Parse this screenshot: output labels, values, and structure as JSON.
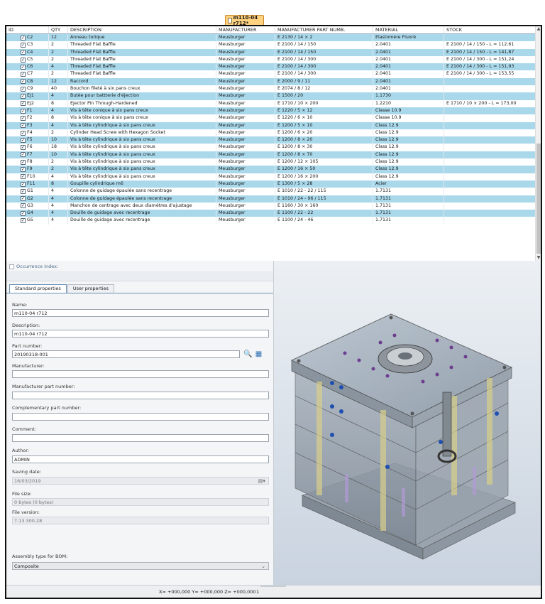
{
  "doc_tab": {
    "label": "m110-04 r712*"
  },
  "grid": {
    "columns": [
      "ID",
      "QTY",
      "DESCRIPTION",
      "MANUFACTURER",
      "MANUFACTURER PART NUMB.",
      "MATERIAL",
      "STOCK"
    ],
    "rows": [
      {
        "id": "C2",
        "qty": "12",
        "desc": "Anneau torique",
        "man": "Meusburger",
        "mpn": "E 2130 / 14 × 2",
        "mat": "Elastomère Fluoré",
        "stock": "",
        "sel": true
      },
      {
        "id": "C3",
        "qty": "2",
        "desc": "Threaded Flat Baffle",
        "man": "Meusburger",
        "mpn": "E 2100 / 14 / 150",
        "mat": "2.0401",
        "stock": "E 2100 / 14 / 150 - L = 112,61",
        "sel": false
      },
      {
        "id": "C4",
        "qty": "2",
        "desc": "Threaded Flat Baffle",
        "man": "Meusburger",
        "mpn": "E 2100 / 14 / 150",
        "mat": "2.0401",
        "stock": "E 2100 / 14 / 150 - L = 141,87",
        "sel": true
      },
      {
        "id": "C5",
        "qty": "2",
        "desc": "Threaded Flat Baffle",
        "man": "Meusburger",
        "mpn": "E 2100 / 14 / 300",
        "mat": "2.0401",
        "stock": "E 2100 / 14 / 300 - L = 151,24",
        "sel": false
      },
      {
        "id": "C6",
        "qty": "4",
        "desc": "Threaded Flat Baffle",
        "man": "Meusburger",
        "mpn": "E 2100 / 14 / 300",
        "mat": "2.0401",
        "stock": "E 2100 / 14 / 300 - L = 151,93",
        "sel": true
      },
      {
        "id": "C7",
        "qty": "2",
        "desc": "Threaded Flat Baffle",
        "man": "Meusburger",
        "mpn": "E 2100 / 14 / 300",
        "mat": "2.0401",
        "stock": "E 2100 / 14 / 300 - L = 153,55",
        "sel": false
      },
      {
        "id": "C8",
        "qty": "12",
        "desc": "Raccord",
        "man": "Meusburger",
        "mpn": "E 2000 / 9 / 11",
        "mat": "2.0401",
        "stock": "",
        "sel": true
      },
      {
        "id": "C9",
        "qty": "40",
        "desc": "Bouchon fileté à six pans creux",
        "man": "Meusburger",
        "mpn": "E 2074 / 8 / 12",
        "mat": "2.0401",
        "stock": "",
        "sel": false
      },
      {
        "id": "EJ1",
        "qty": "4",
        "desc": "Butée pour battterie d'éjection",
        "man": "Meusburger",
        "mpn": "E 1500 / 20",
        "mat": "1.1730",
        "stock": "",
        "sel": true
      },
      {
        "id": "EJ2",
        "qty": "8",
        "desc": "Ejector Pin Through-Hardened",
        "man": "Meusburger",
        "mpn": "E 1710 / 10 × 200",
        "mat": "1.2210",
        "stock": "E 1710 / 10 × 200 - L = 173,00",
        "sel": false
      },
      {
        "id": "F1",
        "qty": "4",
        "desc": "Vis à tête conique à six pans creux",
        "man": "Meusburger",
        "mpn": "E 1220 / 5 × 12",
        "mat": "Classe 10.9",
        "stock": "",
        "sel": true
      },
      {
        "id": "F2",
        "qty": "8",
        "desc": "Vis à tête conique à six pans creux",
        "man": "Meusburger",
        "mpn": "E 1220 / 6 × 10",
        "mat": "Classe 10.9",
        "stock": "",
        "sel": false
      },
      {
        "id": "F3",
        "qty": "4",
        "desc": "Vis à tête cylindrique à six pans creux",
        "man": "Meusburger",
        "mpn": "E 1200 / 5 × 10",
        "mat": "Class 12.9",
        "stock": "",
        "sel": true
      },
      {
        "id": "F4",
        "qty": "2",
        "desc": "Cylinder Head Screw with Hexagon Socket",
        "man": "Meusburger",
        "mpn": "E 1200 / 6 × 20",
        "mat": "Class 12.9",
        "stock": "",
        "sel": false
      },
      {
        "id": "F5",
        "qty": "10",
        "desc": "Vis à tête cylindrique à six pans creux",
        "man": "Meusburger",
        "mpn": "E 1200 / 8 × 20",
        "mat": "Class 12.9",
        "stock": "",
        "sel": true
      },
      {
        "id": "F6",
        "qty": "18",
        "desc": "Vis à tête cylindrique à six pans creux",
        "man": "Meusburger",
        "mpn": "E 1200 / 8 × 30",
        "mat": "Class 12.9",
        "stock": "",
        "sel": false
      },
      {
        "id": "F7",
        "qty": "10",
        "desc": "Vis à tête cylindrique à six pans creux",
        "man": "Meusburger",
        "mpn": "E 1200 / 8 × 70",
        "mat": "Class 12.9",
        "stock": "",
        "sel": true
      },
      {
        "id": "F8",
        "qty": "2",
        "desc": "Vis à tête cylindrique à six pans creux",
        "man": "Meusburger",
        "mpn": "E 1200 / 12 × 105",
        "mat": "Class 12.9",
        "stock": "",
        "sel": false
      },
      {
        "id": "F9",
        "qty": "2",
        "desc": "Vis à tête cylindrique à six pans creux",
        "man": "Meusburger",
        "mpn": "E 1200 / 16 × 50",
        "mat": "Class 12.9",
        "stock": "",
        "sel": true
      },
      {
        "id": "F10",
        "qty": "4",
        "desc": "Vis à tête cylindrique à six pans creux",
        "man": "Meusburger",
        "mpn": "E 1200 / 16 × 200",
        "mat": "Class 12.9",
        "stock": "",
        "sel": false
      },
      {
        "id": "F11",
        "qty": "8",
        "desc": "Goupille cylindrique m6",
        "man": "Meusburger",
        "mpn": "E 1300 / 5 × 28",
        "mat": "Acier",
        "stock": "",
        "sel": true
      },
      {
        "id": "G1",
        "qty": "4",
        "desc": "Colonne de guidage épaulée sans recentrage",
        "man": "Meusburger",
        "mpn": "E 1010 / 22 - 22 / 115",
        "mat": "1.7131",
        "stock": "",
        "sel": false
      },
      {
        "id": "G2",
        "qty": "4",
        "desc": "Colonne de guidage épaulée sans recentrage",
        "man": "Meusburger",
        "mpn": "E 1010 / 24 - 96 / 115",
        "mat": "1.7131",
        "stock": "",
        "sel": true
      },
      {
        "id": "G3",
        "qty": "4",
        "desc": "Manchon de centrage avec deux diamètres d'ajustage",
        "man": "Meusburger",
        "mpn": "E 1160 / 30 × 160",
        "mat": "1.7131",
        "stock": "",
        "sel": false
      },
      {
        "id": "G4",
        "qty": "4",
        "desc": "Douille de guidage avec recentrage",
        "man": "Meusburger",
        "mpn": "E 1100 / 22 - 22",
        "mat": "1.7131",
        "stock": "",
        "sel": true
      },
      {
        "id": "G5",
        "qty": "4",
        "desc": "Douille de guidage avec recentrage",
        "man": "Meusburger",
        "mpn": "E 1100 / 24 - 46",
        "mat": "1.7131",
        "stock": "",
        "sel": false
      }
    ]
  },
  "occurrence": {
    "label": "Occurrence index:"
  },
  "tabs": {
    "standard": "Standard properties",
    "user": "User properties"
  },
  "props": {
    "name_label": "Name:",
    "name_value": "m110-04 r712",
    "desc_label": "Description:",
    "desc_value": "m110-04 r712",
    "pn_label": "Part number:",
    "pn_value": "20190318-001",
    "man_label": "Manufacturer:",
    "man_value": "",
    "mpn_label": "Manufacturer part number:",
    "mpn_value": "",
    "cpn_label": "Complementary part number:",
    "cpn_value": "",
    "comment_label": "Comment:",
    "comment_value": "",
    "author_label": "Author:",
    "author_value": "ADMIN",
    "saving_label": "Saving date:",
    "saving_value": "16/03/2019",
    "filesize_label": "File size:",
    "filesize_value": "0 bytes (0 bytes)",
    "filever_label": "File version:",
    "filever_value": "7.13.300.28",
    "asm_label": "Assembly type for BOM:",
    "asm_value": "Composite"
  },
  "status": {
    "coords": "X= +000,000   Y= +000,000   Z= +000,000",
    "index": "1"
  },
  "colors": {
    "selected_row": "#a8d8ea",
    "tab_accent": "#ffd27f"
  },
  "icons": {
    "doc": "document-icon",
    "search": "search-icon",
    "browse": "browse-icon",
    "calendar": "calendar-icon",
    "dropdown": "chevron-down-icon",
    "check": "checkbox-icon"
  }
}
